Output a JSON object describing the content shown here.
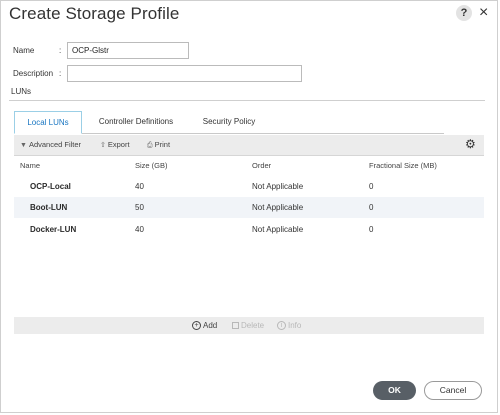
{
  "dialog": {
    "title": "Create Storage Profile",
    "help_label": "?",
    "close_label": "×"
  },
  "form": {
    "name_label": "Name",
    "name_value": "OCP-Glstr",
    "description_label": "Description",
    "description_value": "",
    "colon": ":"
  },
  "section": {
    "title": "LUNs"
  },
  "tabs": [
    {
      "label": "Local LUNs",
      "active": true
    },
    {
      "label": "Controller Definitions",
      "active": false
    },
    {
      "label": "Security Policy",
      "active": false
    }
  ],
  "toolbar": {
    "advanced_filter": "Advanced Filter",
    "export": "Export",
    "print": "Print"
  },
  "table": {
    "columns": [
      "Name",
      "Size (GB)",
      "Order",
      "Fractional Size (MB)"
    ],
    "rows": [
      [
        "OCP-Local",
        "40",
        "Not Applicable",
        "0"
      ],
      [
        "Boot-LUN",
        "50",
        "Not Applicable",
        "0"
      ],
      [
        "Docker-LUN",
        "40",
        "Not Applicable",
        "0"
      ]
    ]
  },
  "actions": {
    "add": "Add",
    "delete": "Delete",
    "info": "Info"
  },
  "footer": {
    "ok": "OK",
    "cancel": "Cancel"
  },
  "colors": {
    "active_tab": "#1976c2",
    "ok_button": "#585f66",
    "toolbar_bg": "#ececec"
  }
}
